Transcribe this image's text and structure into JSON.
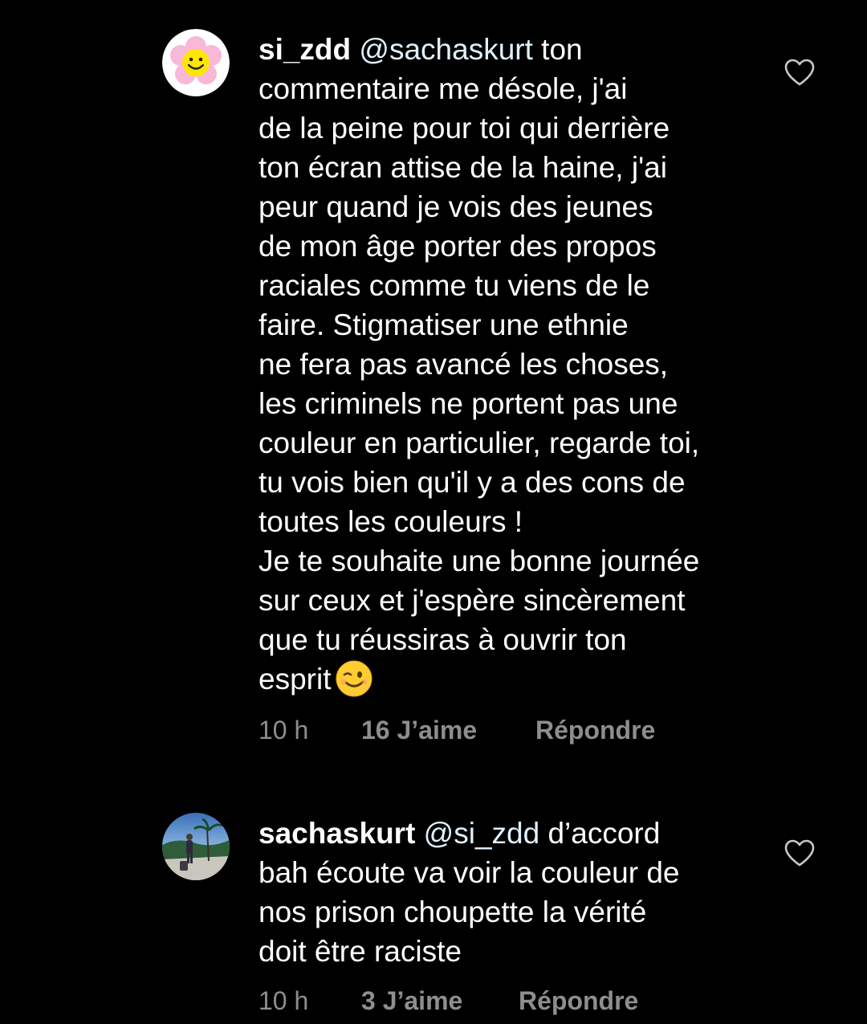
{
  "comments": [
    {
      "username": "si_zdd",
      "avatar_icon": "smiley-flower-icon",
      "mention": "@sachaskurt",
      "first_line_rest": " ton",
      "lines": [
        "commentaire me désole, j'ai",
        "de la peine pour toi qui derrière",
        "ton écran attise de la haine, j'ai",
        "peur quand je vois des jeunes",
        "de mon âge porter des propos",
        "raciales comme tu viens de le",
        "faire.  Stigmatiser une ethnie",
        "ne fera pas avancé les choses,",
        "les criminels ne portent pas une",
        "couleur en particulier, regarde toi,",
        "tu vois bien qu'il y a des cons de",
        "toutes les couleurs !",
        "Je te souhaite une bonne journée",
        "sur ceux et j'espère sincèrement",
        "que tu réussiras à ouvrir ton"
      ],
      "last_line": "esprit",
      "last_emoji_icon": "winking-face-icon",
      "time": "10 h",
      "likes": "16 J’aime",
      "reply": "Répondre",
      "like_icon": "heart-outline-icon"
    },
    {
      "username": "sachaskurt",
      "avatar_icon": "beach-photo-avatar",
      "mention": "@si_zdd",
      "first_line_rest": " d’accord",
      "lines": [
        "bah écoute va voir la couleur de",
        "nos prison choupette la vérité",
        "doit être raciste"
      ],
      "time": "10 h",
      "likes": "3 J’aime",
      "reply": "Répondre",
      "like_icon": "heart-outline-icon"
    }
  ],
  "colors": {
    "background": "#000000",
    "text": "#ffffff",
    "meta": "#8e8e8e",
    "mention": "#e0f1ff"
  }
}
